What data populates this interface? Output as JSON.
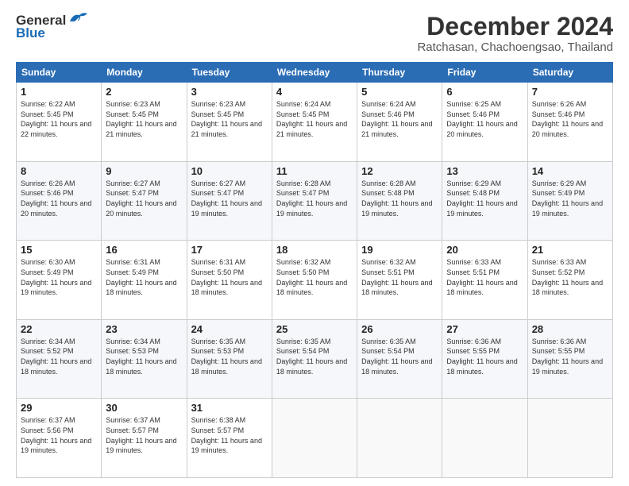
{
  "header": {
    "logo_general": "General",
    "logo_blue": "Blue",
    "title": "December 2024",
    "subtitle": "Ratchasan, Chachoengsao, Thailand"
  },
  "calendar": {
    "days_of_week": [
      "Sunday",
      "Monday",
      "Tuesday",
      "Wednesday",
      "Thursday",
      "Friday",
      "Saturday"
    ],
    "weeks": [
      [
        {
          "day": "",
          "detail": ""
        },
        {
          "day": "2",
          "detail": "Sunrise: 6:23 AM\nSunset: 5:45 PM\nDaylight: 11 hours\nand 21 minutes."
        },
        {
          "day": "3",
          "detail": "Sunrise: 6:23 AM\nSunset: 5:45 PM\nDaylight: 11 hours\nand 21 minutes."
        },
        {
          "day": "4",
          "detail": "Sunrise: 6:24 AM\nSunset: 5:45 PM\nDaylight: 11 hours\nand 21 minutes."
        },
        {
          "day": "5",
          "detail": "Sunrise: 6:24 AM\nSunset: 5:46 PM\nDaylight: 11 hours\nand 21 minutes."
        },
        {
          "day": "6",
          "detail": "Sunrise: 6:25 AM\nSunset: 5:46 PM\nDaylight: 11 hours\nand 20 minutes."
        },
        {
          "day": "7",
          "detail": "Sunrise: 6:26 AM\nSunset: 5:46 PM\nDaylight: 11 hours\nand 20 minutes."
        }
      ],
      [
        {
          "day": "1",
          "detail": "Sunrise: 6:22 AM\nSunset: 5:45 PM\nDaylight: 11 hours\nand 22 minutes."
        },
        {
          "day": "9",
          "detail": "Sunrise: 6:27 AM\nSunset: 5:47 PM\nDaylight: 11 hours\nand 20 minutes."
        },
        {
          "day": "10",
          "detail": "Sunrise: 6:27 AM\nSunset: 5:47 PM\nDaylight: 11 hours\nand 19 minutes."
        },
        {
          "day": "11",
          "detail": "Sunrise: 6:28 AM\nSunset: 5:47 PM\nDaylight: 11 hours\nand 19 minutes."
        },
        {
          "day": "12",
          "detail": "Sunrise: 6:28 AM\nSunset: 5:48 PM\nDaylight: 11 hours\nand 19 minutes."
        },
        {
          "day": "13",
          "detail": "Sunrise: 6:29 AM\nSunset: 5:48 PM\nDaylight: 11 hours\nand 19 minutes."
        },
        {
          "day": "14",
          "detail": "Sunrise: 6:29 AM\nSunset: 5:49 PM\nDaylight: 11 hours\nand 19 minutes."
        }
      ],
      [
        {
          "day": "8",
          "detail": "Sunrise: 6:26 AM\nSunset: 5:46 PM\nDaylight: 11 hours\nand 20 minutes."
        },
        {
          "day": "16",
          "detail": "Sunrise: 6:31 AM\nSunset: 5:49 PM\nDaylight: 11 hours\nand 18 minutes."
        },
        {
          "day": "17",
          "detail": "Sunrise: 6:31 AM\nSunset: 5:50 PM\nDaylight: 11 hours\nand 18 minutes."
        },
        {
          "day": "18",
          "detail": "Sunrise: 6:32 AM\nSunset: 5:50 PM\nDaylight: 11 hours\nand 18 minutes."
        },
        {
          "day": "19",
          "detail": "Sunrise: 6:32 AM\nSunset: 5:51 PM\nDaylight: 11 hours\nand 18 minutes."
        },
        {
          "day": "20",
          "detail": "Sunrise: 6:33 AM\nSunset: 5:51 PM\nDaylight: 11 hours\nand 18 minutes."
        },
        {
          "day": "21",
          "detail": "Sunrise: 6:33 AM\nSunset: 5:52 PM\nDaylight: 11 hours\nand 18 minutes."
        }
      ],
      [
        {
          "day": "15",
          "detail": "Sunrise: 6:30 AM\nSunset: 5:49 PM\nDaylight: 11 hours\nand 19 minutes."
        },
        {
          "day": "23",
          "detail": "Sunrise: 6:34 AM\nSunset: 5:53 PM\nDaylight: 11 hours\nand 18 minutes."
        },
        {
          "day": "24",
          "detail": "Sunrise: 6:35 AM\nSunset: 5:53 PM\nDaylight: 11 hours\nand 18 minutes."
        },
        {
          "day": "25",
          "detail": "Sunrise: 6:35 AM\nSunset: 5:54 PM\nDaylight: 11 hours\nand 18 minutes."
        },
        {
          "day": "26",
          "detail": "Sunrise: 6:35 AM\nSunset: 5:54 PM\nDaylight: 11 hours\nand 18 minutes."
        },
        {
          "day": "27",
          "detail": "Sunrise: 6:36 AM\nSunset: 5:55 PM\nDaylight: 11 hours\nand 18 minutes."
        },
        {
          "day": "28",
          "detail": "Sunrise: 6:36 AM\nSunset: 5:55 PM\nDaylight: 11 hours\nand 19 minutes."
        }
      ],
      [
        {
          "day": "22",
          "detail": "Sunrise: 6:34 AM\nSunset: 5:52 PM\nDaylight: 11 hours\nand 18 minutes."
        },
        {
          "day": "30",
          "detail": "Sunrise: 6:37 AM\nSunset: 5:57 PM\nDaylight: 11 hours\nand 19 minutes."
        },
        {
          "day": "31",
          "detail": "Sunrise: 6:38 AM\nSunset: 5:57 PM\nDaylight: 11 hours\nand 19 minutes."
        },
        {
          "day": "",
          "detail": ""
        },
        {
          "day": "",
          "detail": ""
        },
        {
          "day": "",
          "detail": ""
        },
        {
          "day": ""
        }
      ],
      [
        {
          "day": "29",
          "detail": "Sunrise: 6:37 AM\nSunset: 5:56 PM\nDaylight: 11 hours\nand 19 minutes."
        },
        {
          "day": "",
          "detail": ""
        },
        {
          "day": "",
          "detail": ""
        },
        {
          "day": "",
          "detail": ""
        },
        {
          "day": "",
          "detail": ""
        },
        {
          "day": "",
          "detail": ""
        },
        {
          "day": "",
          "detail": ""
        }
      ]
    ]
  }
}
